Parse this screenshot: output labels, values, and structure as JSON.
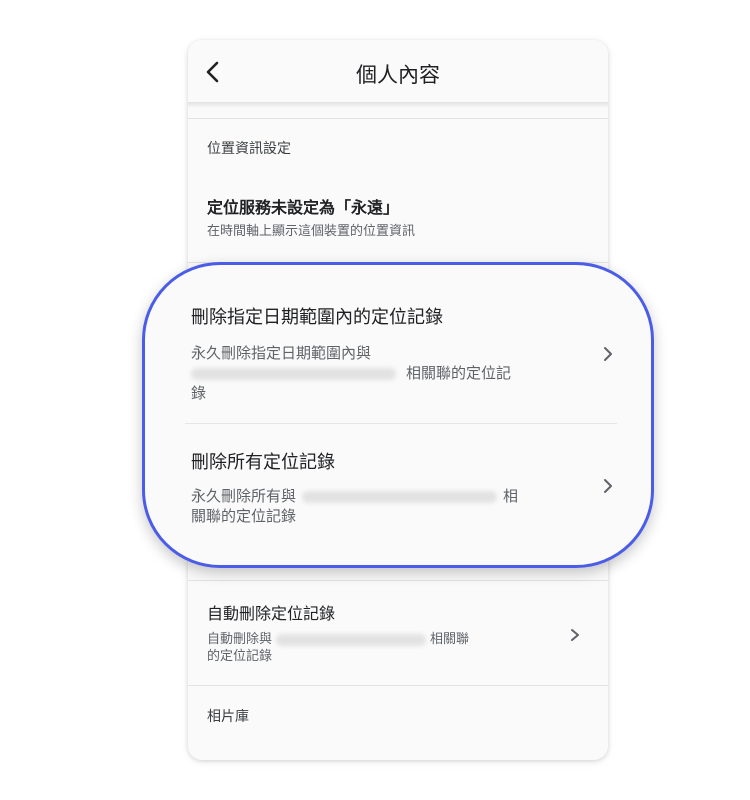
{
  "header": {
    "title": "個人內容"
  },
  "icons": {
    "back": "chevron-left-icon",
    "row_arrow": "chevron-right-icon"
  },
  "colors": {
    "highlight_border": "#4a5ce8",
    "card_bg": "#fafafa"
  },
  "location_section": {
    "label": "位置資訊設定",
    "location_service": {
      "title": "定位服務未設定為「永遠」",
      "subtitle": "在時間軸上顯示這個裝置的位置資訊"
    }
  },
  "delete_range": {
    "title": "刪除指定日期範圍內的定位記錄",
    "subtitle_prefix": "永久刪除指定日期範圍內與",
    "subtitle_suffix": "相關聯的定位記",
    "subtitle_tail": "錄"
  },
  "delete_all": {
    "title": "刪除所有定位記錄",
    "subtitle_prefix": "永久刪除所有與",
    "subtitle_suffix": "相",
    "subtitle_tail": "關聯的定位記錄"
  },
  "auto_delete": {
    "title": "自動刪除定位記錄",
    "subtitle_prefix": "自動刪除與",
    "subtitle_suffix": "相關聯",
    "subtitle_tail": "的定位記錄"
  },
  "photos_section": {
    "label": "相片庫"
  }
}
